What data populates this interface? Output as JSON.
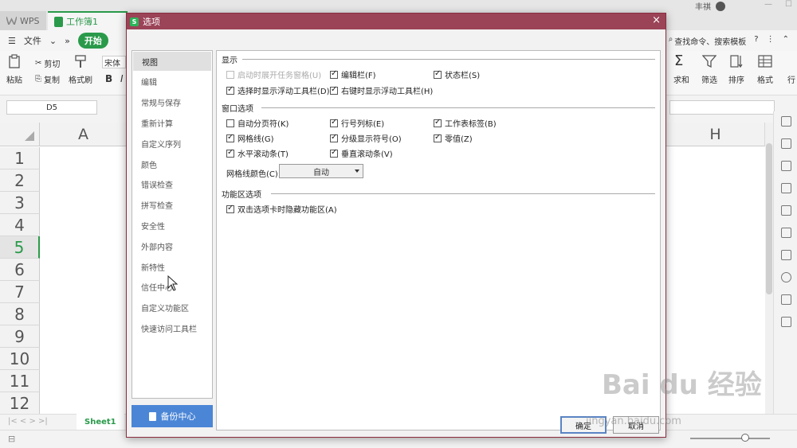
{
  "app": {
    "wps_tab": "WPS",
    "doc_tab": "工作簿1",
    "user": "丰祺",
    "menu_file": "文件",
    "menu_start": "开始",
    "search_cmd": "查找命令、搜索模板",
    "font_name": "宋体",
    "paste": "粘贴",
    "cut": "剪切",
    "copy": "复制",
    "format_painter": "格式刷",
    "sum": "求和",
    "filter": "筛选",
    "sort": "排序",
    "format": "格式",
    "bold": "B",
    "italic": "I",
    "row_col": "行",
    "name_box": "D5",
    "columns": [
      "A",
      "H"
    ],
    "rows": [
      "1",
      "2",
      "3",
      "4",
      "5",
      "6",
      "7",
      "8",
      "9",
      "10",
      "11",
      "12"
    ],
    "active_row": "5",
    "sheet_tab": "Sheet1"
  },
  "dialog": {
    "title": "选项",
    "close_label": "×",
    "nav": [
      "视图",
      "编辑",
      "常规与保存",
      "重新计算",
      "自定义序列",
      "颜色",
      "错误检查",
      "拼写检查",
      "安全性",
      "外部内容",
      "新特性",
      "信任中心",
      "自定义功能区",
      "快速访问工具栏"
    ],
    "selected_nav": "视图",
    "backup_label": "备份中心",
    "sections": {
      "display": {
        "title": "显示",
        "options": [
          {
            "label": "启动时展开任务窗格(U)",
            "checked": false,
            "disabled": true
          },
          {
            "label": "编辑栏(F)",
            "checked": true
          },
          {
            "label": "状态栏(S)",
            "checked": true
          },
          {
            "label": "选择时显示浮动工具栏(D)",
            "checked": true
          },
          {
            "label": "右键时显示浮动工具栏(H)",
            "checked": true
          }
        ]
      },
      "window": {
        "title": "窗口选项",
        "options": [
          {
            "label": "自动分页符(K)",
            "checked": false
          },
          {
            "label": "行号列标(E)",
            "checked": true
          },
          {
            "label": "工作表标签(B)",
            "checked": true
          },
          {
            "label": "网格线(G)",
            "checked": true
          },
          {
            "label": "分级显示符号(O)",
            "checked": true
          },
          {
            "label": "零值(Z)",
            "checked": true
          },
          {
            "label": "水平滚动条(T)",
            "checked": true
          },
          {
            "label": "垂直滚动条(V)",
            "checked": true
          }
        ],
        "gridline_color_label": "网格线颜色(C):",
        "gridline_color_value": "自动"
      },
      "ribbon": {
        "title": "功能区选项",
        "options": [
          {
            "label": "双击选项卡时隐藏功能区(A)",
            "checked": true
          }
        ]
      }
    },
    "ok_label": "确定",
    "cancel_label": "取消"
  },
  "watermark": {
    "logo": "Bai du 经验",
    "url": "jingyan.baidu.com"
  },
  "colors": {
    "accent_green": "#2a9a4a",
    "dialog_title": "#9b4357",
    "backup_blue": "#4b86d6"
  }
}
